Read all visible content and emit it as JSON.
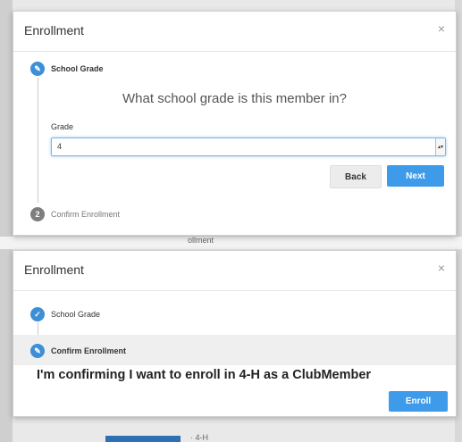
{
  "background": {
    "snippet_1": "ollment",
    "snippet_2": "· 4-H"
  },
  "modal1": {
    "title": "Enrollment",
    "close": "×",
    "step1_label": "School Grade",
    "question": "What school grade is this member in?",
    "field_label": "Grade",
    "select_value": "4",
    "back_label": "Back",
    "next_label": "Next",
    "step2_number": "2",
    "step2_label": "Confirm Enrollment"
  },
  "modal2": {
    "title": "Enrollment",
    "close": "×",
    "step1_label": "School Grade",
    "step2_label": "Confirm Enrollment",
    "confirm_text": "I'm confirming I want to enroll in 4-H as a ClubMember",
    "enroll_label": "Enroll"
  },
  "colors": {
    "accent": "#3d9be9",
    "step_icon": "#3d8fd6"
  }
}
